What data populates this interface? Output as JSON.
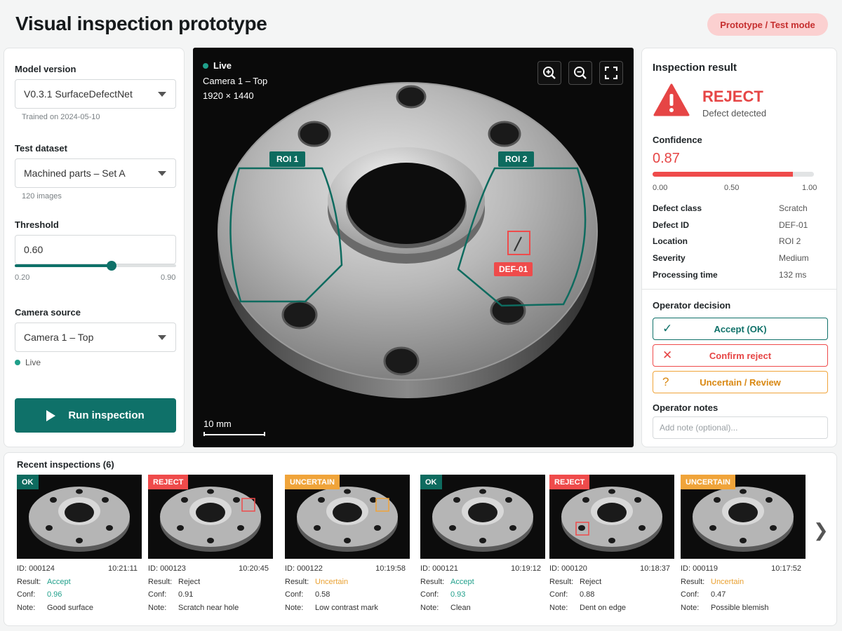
{
  "app": {
    "title": "Visual inspection prototype",
    "mode_badge": "Prototype / Test mode"
  },
  "controls": {
    "model_label": "Model version",
    "model_value": "V0.3.1  SurfaceDefectNet",
    "model_hint": "Trained on 2024-05-10",
    "dataset_label": "Test dataset",
    "dataset_value": "Machined parts – Set A",
    "dataset_hint": "120 images",
    "threshold_label": "Threshold",
    "threshold_value": "0.60",
    "threshold_min": "0.20",
    "threshold_max": "0.90",
    "threshold_fraction": 0.6,
    "camera_label": "Camera source",
    "camera_value": "Camera 1 – Top",
    "camera_status": "Live",
    "run_label": "Run inspection"
  },
  "viewer": {
    "status": "Live",
    "camera": "Camera 1 – Top",
    "resolution": "1920 × 1440",
    "roi1": "ROI 1",
    "roi2": "ROI 2",
    "defect_tag": "DEF-01",
    "scale": "10 mm",
    "icons": [
      "zoom-in-icon",
      "zoom-out-icon",
      "fullscreen-icon"
    ]
  },
  "result": {
    "heading": "Inspection result",
    "verdict": "REJECT",
    "verdict_sub": "Defect detected",
    "confidence_label": "Confidence",
    "confidence": "0.87",
    "confidence_fraction": 0.87,
    "ticks": [
      "0.00",
      "0.50",
      "1.00"
    ],
    "details": [
      {
        "key": "Defect class",
        "value": "Scratch"
      },
      {
        "key": "Defect ID",
        "value": "DEF-01"
      },
      {
        "key": "Location",
        "value": "ROI 2"
      },
      {
        "key": "Severity",
        "value": "Medium"
      },
      {
        "key": "Processing time",
        "value": "132 ms"
      }
    ],
    "decision_label": "Operator decision",
    "accept_label": "Accept (OK)",
    "reject_label": "Confirm reject",
    "uncertain_label": "Uncertain / Review",
    "notes_label": "Operator notes",
    "notes_placeholder": "Add note (optional)..."
  },
  "recent": {
    "title": "Recent inspections (6)",
    "labels": {
      "result": "Result:",
      "conf": "Conf:",
      "note": "Note:"
    },
    "items": [
      {
        "badge": "OK",
        "id": "ID: 000124",
        "time": "10:21:11",
        "result": "Accept",
        "conf": "0.96",
        "note": "Good surface"
      },
      {
        "badge": "REJECT",
        "id": "ID: 000123",
        "time": "10:20:45",
        "result": "Reject",
        "conf": "0.91",
        "note": "Scratch near hole"
      },
      {
        "badge": "UNCERTAIN",
        "id": "ID: 000122",
        "time": "10:19:58",
        "result": "Uncertain",
        "conf": "0.58",
        "note": "Low contrast mark"
      },
      {
        "badge": "OK",
        "id": "ID: 000121",
        "time": "10:19:12",
        "result": "Accept",
        "conf": "0.93",
        "note": "Clean"
      },
      {
        "badge": "REJECT",
        "id": "ID: 000120",
        "time": "10:18:37",
        "result": "Reject",
        "conf": "0.88",
        "note": "Dent on edge"
      },
      {
        "badge": "UNCERTAIN",
        "id": "ID: 000119",
        "time": "10:17:52",
        "result": "Uncertain",
        "conf": "0.47",
        "note": "Possible blemish"
      }
    ]
  },
  "colors": {
    "accent": "#0f7169",
    "reject": "#ef4b4b",
    "uncertain": "#f0a43a",
    "ok": "#0e6b5f"
  }
}
